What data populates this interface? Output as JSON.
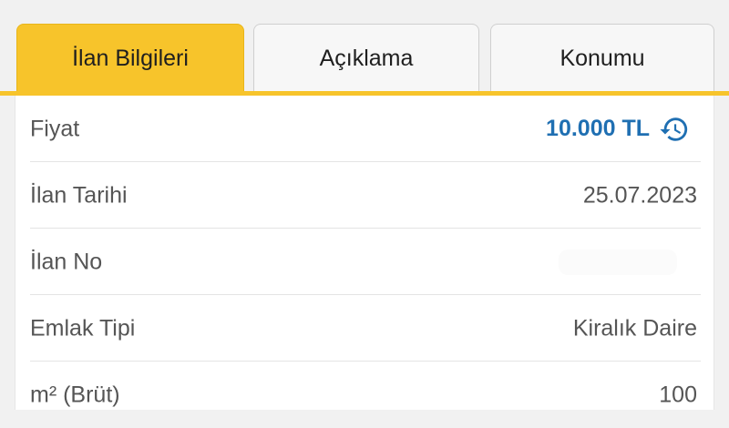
{
  "tabs": {
    "active": "İlan Bilgileri",
    "second": "Açıklama",
    "third": "Konumu"
  },
  "colors": {
    "accent_yellow": "#f7c42b",
    "price_blue": "#1f6fb2"
  },
  "icons": {
    "price_history": "history-icon"
  },
  "details": {
    "price": {
      "label": "Fiyat",
      "value": "10.000 TL"
    },
    "date": {
      "label": "İlan Tarihi",
      "value": "25.07.2023"
    },
    "listing_no": {
      "label": "İlan No",
      "value": ""
    },
    "property_type": {
      "label": "Emlak Tipi",
      "value": "Kiralık Daire"
    },
    "gross_area": {
      "label": "m² (Brüt)",
      "value": "100"
    }
  }
}
